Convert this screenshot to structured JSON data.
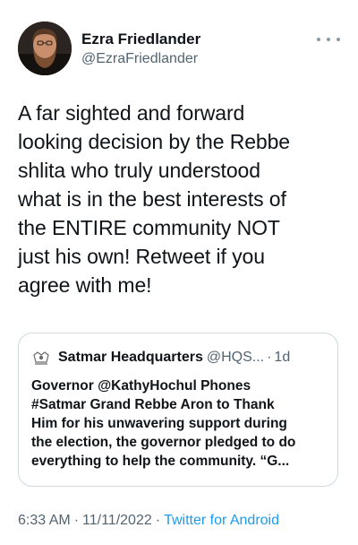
{
  "author": {
    "display_name": "Ezra Friedlander",
    "handle": "@EzraFriedlander",
    "avatar": "profile-photo",
    "more_icon": "more-icon"
  },
  "tweet": {
    "text": "A far sighted and forward\nlooking decision by the Rebbe\nshlita who truly understood\nwhat is in the best interests of\nthe ENTIRE community NOT\njust his own! Retweet if you\nagree with me!"
  },
  "quoted_tweet": {
    "avatar_icon": "satmar-emblem-icon",
    "display_name": "Satmar Headquarters",
    "handle": "@HQS...",
    "separator": "·",
    "time": "1d",
    "text": "Governor @KathyHochul Phones\n#Satmar Grand Rebbe Aron to Thank\nHim for his unwavering support during\nthe election, the governor pledged to do\neverything to help the community. “G..."
  },
  "meta": {
    "time": "6:33 AM",
    "date": "11/11/2022",
    "source": "Twitter for Android",
    "separator": "·"
  },
  "colors": {
    "text": "#0f1419",
    "secondary": "#536471",
    "accent": "#1d9bf0",
    "border": "#cfd9de"
  }
}
